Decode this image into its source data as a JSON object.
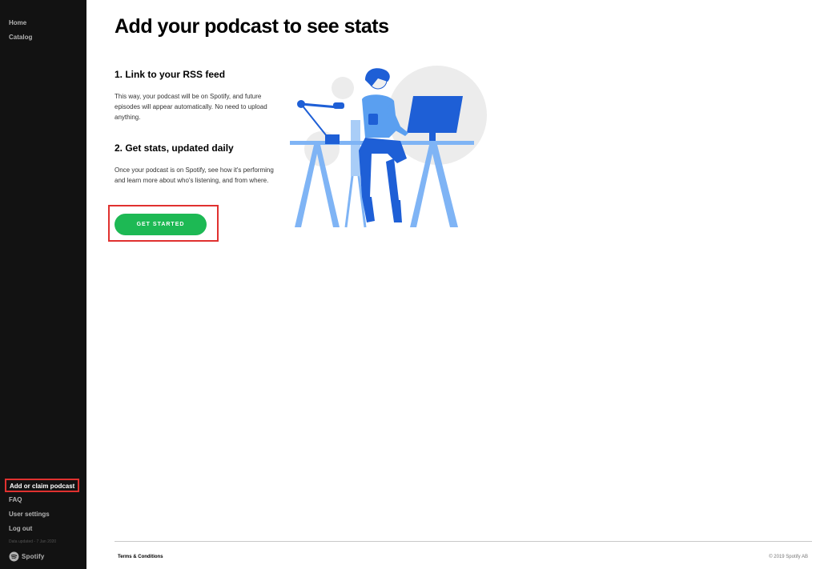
{
  "sidebar": {
    "nav_top": [
      "Home",
      "Catalog"
    ],
    "active_item": "Add or claim podcast",
    "nav_bottom": [
      "FAQ",
      "User settings",
      "Log out"
    ],
    "data_updated": "Data updated - 7 Jan 2020",
    "logo_text": "Spotify"
  },
  "main": {
    "title": "Add your podcast to see stats",
    "sections": [
      {
        "heading": "1. Link to your RSS feed",
        "body": "This way, your podcast will be on Spotify, and future episodes will appear automatically. No need to upload anything."
      },
      {
        "heading": "2. Get stats, updated daily",
        "body": "Once your podcast is on Spotify, see how it's performing and learn more about who's listening, and from where."
      }
    ],
    "cta_label": "GET STARTED"
  },
  "footer": {
    "terms": "Terms & Conditions",
    "copyright": "© 2019 Spotify AB"
  },
  "colors": {
    "sidebar_bg": "#121212",
    "accent_green": "#1db954",
    "highlight_red": "#e0312f",
    "illustration_blue": "#1e5fd6",
    "illustration_light_blue": "#7fb4f5"
  },
  "icons": {
    "logo": "spotify-logo-icon",
    "illustration": "podcaster-at-desk-illustration"
  }
}
